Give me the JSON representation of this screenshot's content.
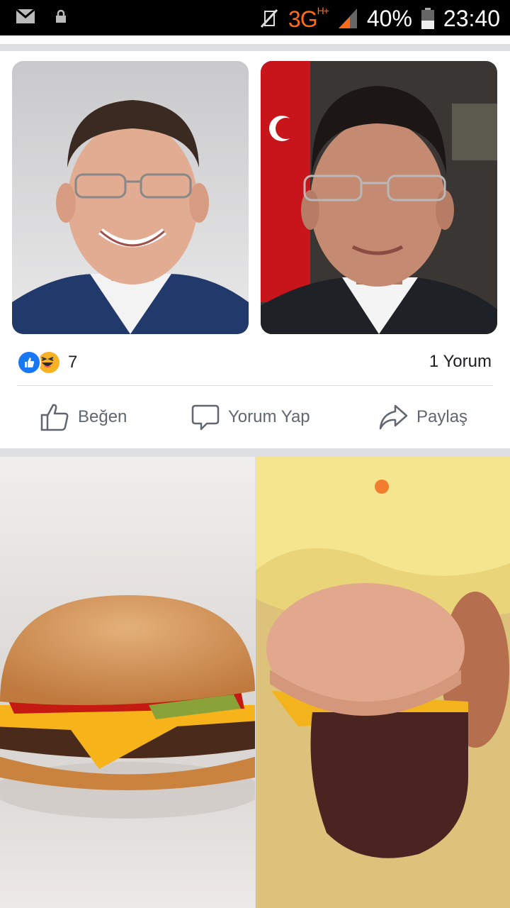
{
  "status_bar": {
    "icons": [
      "mail-icon",
      "lock-icon",
      "mute-icon",
      "signal-icon",
      "battery-icon"
    ],
    "network": "3G",
    "network_sup": "H+",
    "battery_percent": "40%",
    "time": "23:40"
  },
  "post": {
    "photos": [
      {
        "name": "portrait-smiling",
        "desc": "portrait photo"
      },
      {
        "name": "portrait-flag",
        "desc": "portrait photo"
      }
    ],
    "reactions": {
      "types": [
        "like",
        "haha"
      ],
      "count": "7"
    },
    "comments_label": "1 Yorum",
    "actions": {
      "like": "Beğen",
      "comment": "Yorum Yap",
      "share": "Paylaş"
    }
  },
  "next_post": {
    "photos": [
      "cheeseburger-advertised",
      "cheeseburger-actual"
    ]
  },
  "colors": {
    "accent": "#1877f2",
    "network": "#ff6a1a",
    "action_text": "#606770",
    "divider": "#dddfe2"
  }
}
